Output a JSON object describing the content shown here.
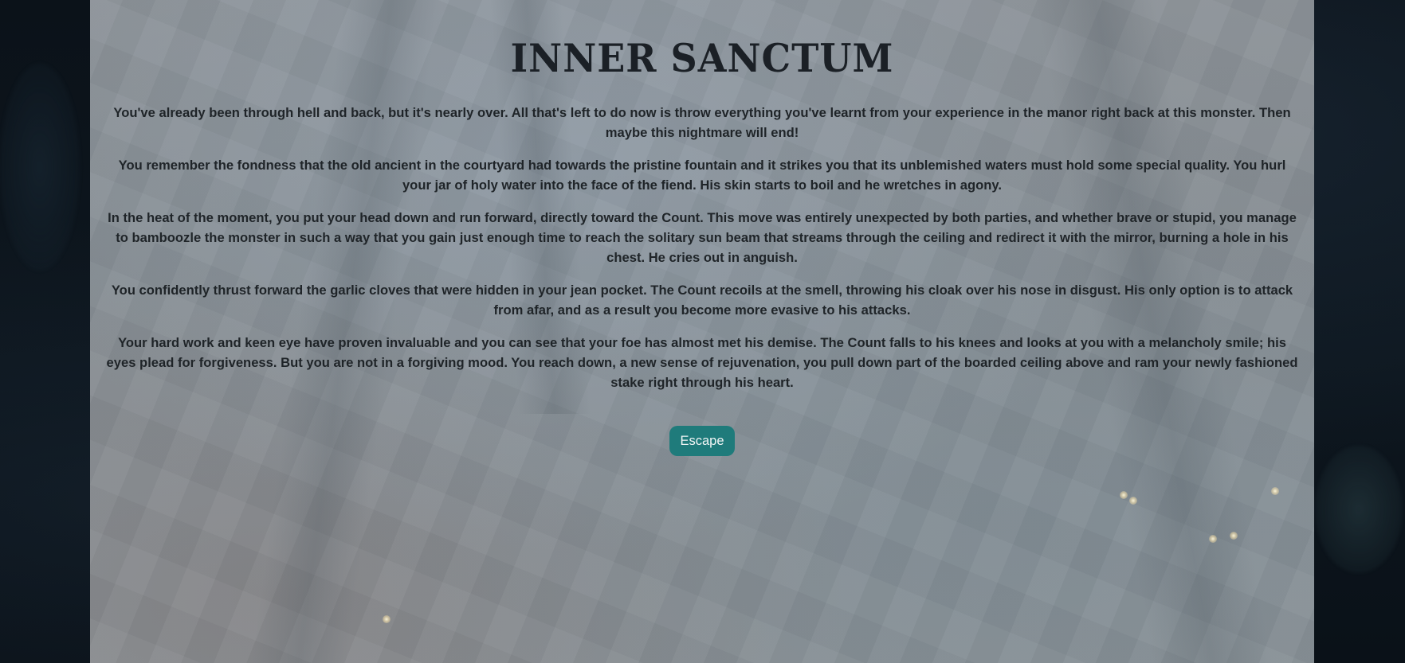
{
  "page": {
    "title": "INNER SANCTUM",
    "paragraphs": [
      "You've already been through hell and back, but it's nearly over. All that's left to do now is throw everything you've learnt from your experience in the manor right back at this monster. Then maybe this nightmare will end!",
      "You remember the fondness that the old ancient in the courtyard had towards the pristine fountain and it strikes you that its unblemished waters must hold some special quality. You hurl your jar of holy water into the face of the fiend. His skin starts to boil and he wretches in agony.",
      "In the heat of the moment, you put your head down and run forward, directly toward the Count. This move was entirely unexpected by both parties, and whether brave or stupid, you manage to bamboozle the monster in such a way that you gain just enough time to reach the solitary sun beam that streams through the ceiling and redirect it with the mirror, burning a hole in his chest. He cries out in anguish.",
      "You confidently thrust forward the garlic cloves that were hidden in your jean pocket. The Count recoils at the smell, throwing his cloak over his nose in disgust. His only option is to attack from afar, and as a result you become more evasive to his attacks.",
      "Your hard work and keen eye have proven invaluable and you can see that your foe has almost met his demise. The Count falls to his knees and looks at you with a melancholy smile; his eyes plead for forgiveness. But you are not in a forgiving mood. You reach down, a new sense of rejuvenation, you pull down part of the boarded ceiling above and ram your newly fashioned stake right through his heart."
    ],
    "escape_label": "Escape"
  },
  "colors": {
    "page_background": "#0d161e",
    "panel_background": "#8a9197",
    "text": "#1f2428",
    "button_background": "#1f7b7b",
    "button_text": "#f2f6f6"
  }
}
